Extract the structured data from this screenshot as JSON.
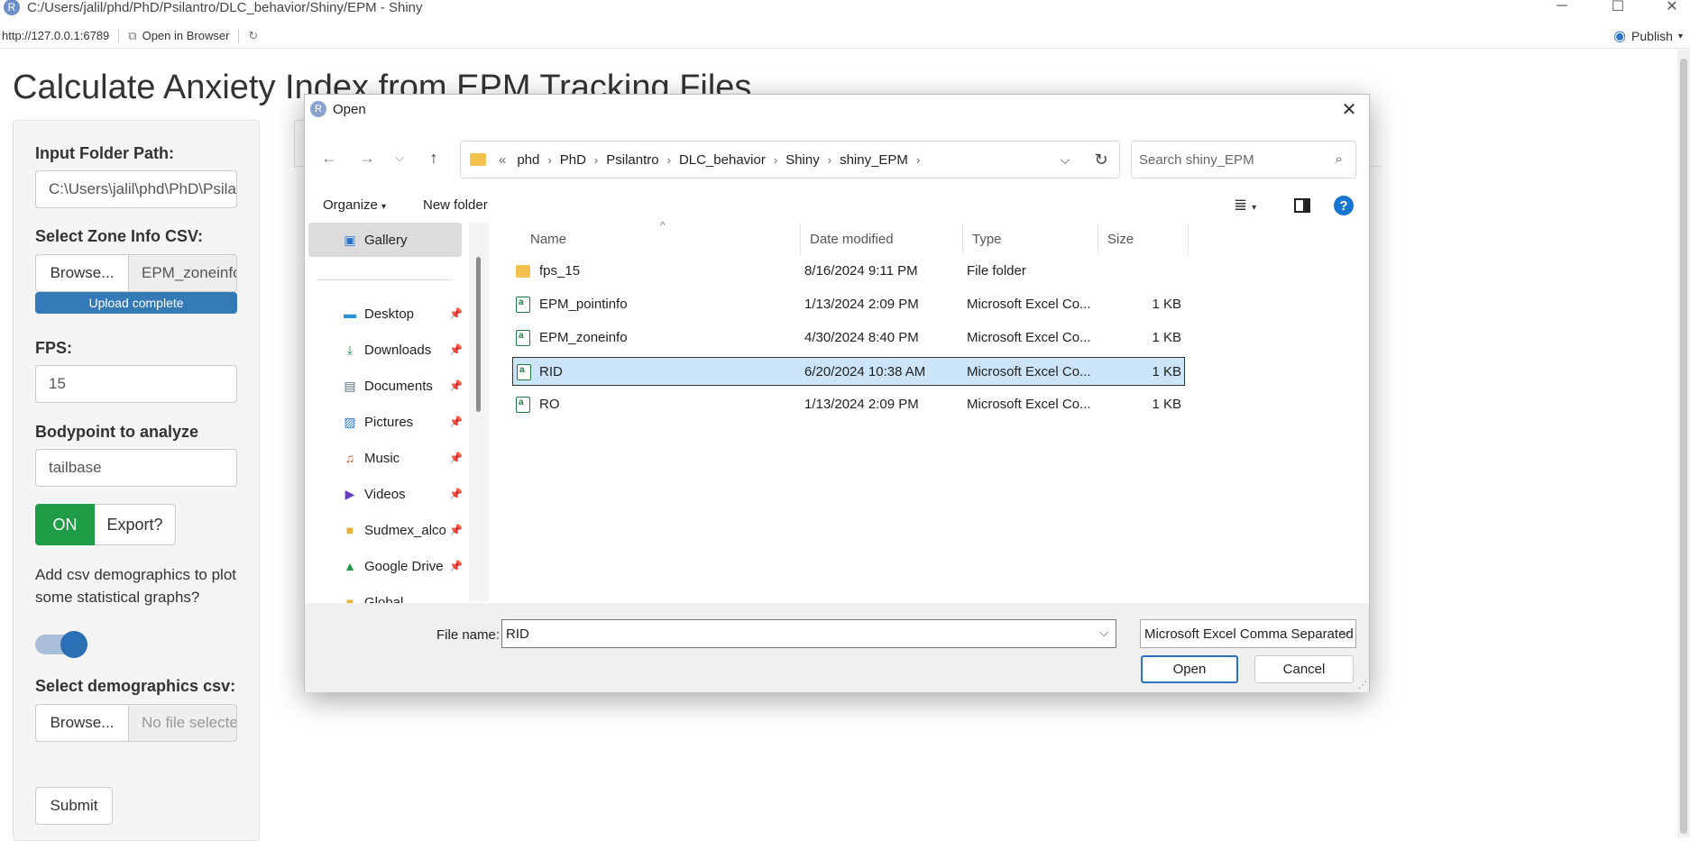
{
  "window": {
    "title": "C:/Users/jalil/phd/PhD/Psilantro/DLC_behavior/Shiny/EPM - Shiny",
    "url": "http://127.0.0.1:6789",
    "open_in_browser": "Open in Browser",
    "publish": "Publish"
  },
  "app": {
    "title": "Calculate Anxiety Index from EPM Tracking Files",
    "input_folder_label": "Input Folder Path:",
    "input_folder_value": "C:\\Users\\jalil\\phd\\PhD\\Psilantro",
    "zone_label": "Select Zone Info CSV:",
    "zone_browse": "Browse...",
    "zone_file": "EPM_zoneinfo.csv",
    "upload_status": "Upload complete",
    "fps_label": "FPS:",
    "fps_value": "15",
    "bodypoint_label": "Bodypoint to analyze",
    "bodypoint_value": "tailbase",
    "export_on": "ON",
    "export_label": "Export?",
    "demographics_text": "Add csv demographics to plot some statistical graphs?",
    "demographics_toggle_on": true,
    "demo_csv_label": "Select demographics csv:",
    "demo_browse": "Browse...",
    "demo_file": "No file selected",
    "submit": "Submit"
  },
  "dialog": {
    "title": "Open",
    "breadcrumb": [
      "«",
      "phd",
      "PhD",
      "Psilantro",
      "DLC_behavior",
      "Shiny",
      "shiny_EPM"
    ],
    "search_placeholder": "Search shiny_EPM",
    "organize": "Organize",
    "new_folder": "New folder",
    "nav_items": [
      {
        "label": "Gallery",
        "icon": "gallery-icon"
      },
      {
        "label": "Desktop",
        "icon": "desktop-icon"
      },
      {
        "label": "Downloads",
        "icon": "download-icon"
      },
      {
        "label": "Documents",
        "icon": "documents-icon"
      },
      {
        "label": "Pictures",
        "icon": "pictures-icon"
      },
      {
        "label": "Music",
        "icon": "music-icon"
      },
      {
        "label": "Videos",
        "icon": "videos-icon"
      },
      {
        "label": "Sudmex_alco",
        "icon": "folder-icon"
      },
      {
        "label": "Google Drive",
        "icon": "google-drive-icon"
      },
      {
        "label": "Global",
        "icon": "folder-icon"
      }
    ],
    "columns": [
      "Name",
      "Date modified",
      "Type",
      "Size"
    ],
    "files": [
      {
        "name": "fps_15",
        "date": "8/16/2024 9:11 PM",
        "type": "File folder",
        "size": "",
        "kind": "folder"
      },
      {
        "name": "EPM_pointinfo",
        "date": "1/13/2024 2:09 PM",
        "type": "Microsoft Excel Co...",
        "size": "1 KB",
        "kind": "xls"
      },
      {
        "name": "EPM_zoneinfo",
        "date": "4/30/2024 8:40 PM",
        "type": "Microsoft Excel Co...",
        "size": "1 KB",
        "kind": "xls"
      },
      {
        "name": "RID",
        "date": "6/20/2024 10:38 AM",
        "type": "Microsoft Excel Co...",
        "size": "1 KB",
        "kind": "xls",
        "selected": true
      },
      {
        "name": "RO",
        "date": "1/13/2024 2:09 PM",
        "type": "Microsoft Excel Co...",
        "size": "1 KB",
        "kind": "xls"
      }
    ],
    "file_name_label": "File name:",
    "file_name_value": "RID",
    "file_type": "Microsoft Excel Comma Separated",
    "open_button": "Open",
    "cancel_button": "Cancel"
  }
}
